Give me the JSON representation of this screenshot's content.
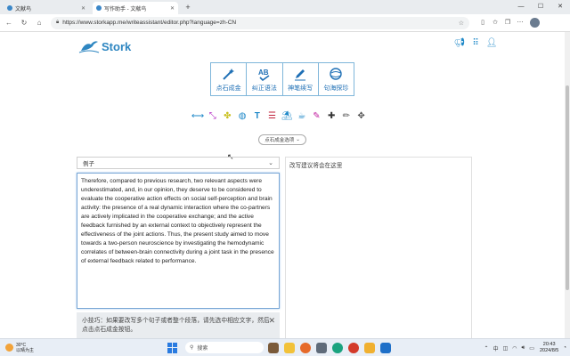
{
  "browser": {
    "tabs": [
      {
        "title": "文献鸟",
        "active": false
      },
      {
        "title": "写作助手 - 文献鸟",
        "active": true
      }
    ],
    "url": "https://www.storkapp.me/writeassistant/editor.php?language=zh-CN"
  },
  "app": {
    "name": "Stork",
    "modes": [
      {
        "label": "点石成金",
        "icon": "magic-wand-icon"
      },
      {
        "label": "纠正语法",
        "icon": "ab-check-icon"
      },
      {
        "label": "神笔续写",
        "icon": "pen-icon"
      },
      {
        "label": "句海探珍",
        "icon": "globe-search-icon"
      }
    ],
    "tools": [
      {
        "icon": "expand-horizontal-icon",
        "color": "#1e88c8"
      },
      {
        "icon": "compress-icon",
        "color": "#b020c0"
      },
      {
        "icon": "puzzle-icon",
        "color": "#c9c020"
      },
      {
        "icon": "globe-icon",
        "color": "#1e88c8"
      },
      {
        "icon": "text-icon",
        "color": "#1e88c8"
      },
      {
        "icon": "list-icon",
        "color": "#c0203a"
      },
      {
        "icon": "beach-icon",
        "color": "#1e88c8"
      },
      {
        "icon": "coffee-icon",
        "color": "#1e88c8"
      },
      {
        "icon": "highlighter-icon",
        "color": "#c020a0"
      },
      {
        "icon": "plus-icon",
        "color": "#333333"
      },
      {
        "icon": "pencil-icon",
        "color": "#555555"
      },
      {
        "icon": "move-icon",
        "color": "#555555"
      }
    ],
    "options_label": "点石成金选项",
    "example_select": "例子",
    "editor_text": "Therefore, compared to previous research, two relevant aspects were underestimated, and, in our opinion, they deserve to be considered to evaluate the cooperative action effects on social self-perception and brain activity: the presence of a real dynamic interaction where the co-partners are actively implicated in the cooperative exchange; and the active feedback furnished by an external context to objectively represent the effectiveness of the joint actions. Thus, the present study aimed to move towards a two-person neuroscience by investigating the hemodynamic correlates of between-brain connectivity during a joint task in the presence of external feedback related to performance.",
    "tip_text": "小技巧：如果要改写多个句子或者整个段落，请先选中相应文字，然后点击点石成金按钮。",
    "suggestions_placeholder": "改写建议将会在这里"
  },
  "taskbar": {
    "weather_temp": "30°C",
    "weather_desc": "以晴为主",
    "search_label": "搜索",
    "lang": "中",
    "time": "20:43",
    "date": "2024/8/5"
  }
}
